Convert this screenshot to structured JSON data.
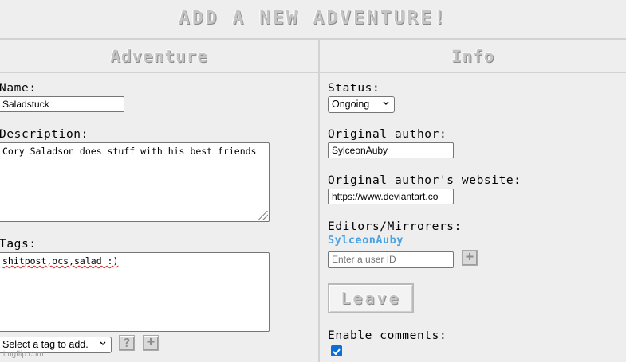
{
  "header": {
    "title": "ADD A NEW ADVENTURE!"
  },
  "columns": {
    "left_title": "Adventure",
    "right_title": "Info"
  },
  "adventure": {
    "name_label": "Name:",
    "name_value": "Saladstuck",
    "description_label": "Description:",
    "description_value": "Cory Saladson does stuff with his best friends",
    "tags_label": "Tags:",
    "tags_value": "shitpost,ocs,salad :)",
    "tag_select_value": "Select a tag to add.",
    "help_icon_glyph": "?",
    "add_tag_icon_glyph": "+"
  },
  "info": {
    "status_label": "Status:",
    "status_value": "Ongoing",
    "author_label": "Original author:",
    "author_value": "SylceonAuby",
    "website_label": "Original author's website:",
    "website_value": "https://www.deviantart.co",
    "editors_label": "Editors/Mirrorers:",
    "editor_name": "SylceonAuby",
    "user_id_placeholder": "Enter a user ID",
    "add_editor_icon_glyph": "+",
    "leave_label": "Leave",
    "comments_label": "Enable comments:",
    "comments_enabled": true
  },
  "watermark": "imgflip.com",
  "colors": {
    "background": "#eeeeee",
    "pixel_text": "#c4c4c4",
    "editor_link": "#4aa3e2",
    "checkbox": "#0b6fd6"
  }
}
